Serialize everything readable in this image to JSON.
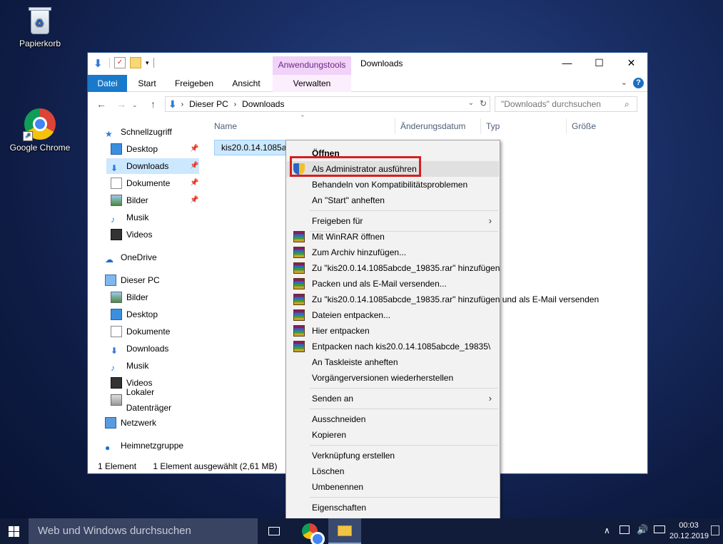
{
  "desktop": {
    "icons": [
      {
        "label": "Papierkorb",
        "icon": "recycle-bin-icon"
      },
      {
        "label": "Google Chrome",
        "icon": "chrome-icon"
      }
    ]
  },
  "explorer": {
    "title": "Downloads",
    "context_tab_header": "Anwendungstools",
    "ribbon_tabs": [
      "Datei",
      "Start",
      "Freigeben",
      "Ansicht",
      "Verwalten"
    ],
    "address": {
      "crumbs": [
        "Dieser PC",
        "Downloads"
      ]
    },
    "search_placeholder": "\"Downloads\" durchsuchen",
    "nav": {
      "quick_access": "Schnellzugriff",
      "quick_items": [
        "Desktop",
        "Downloads",
        "Dokumente",
        "Bilder",
        "Musik",
        "Videos"
      ],
      "onedrive": "OneDrive",
      "this_pc": "Dieser PC",
      "pc_items": [
        "Bilder",
        "Desktop",
        "Dokumente",
        "Downloads",
        "Musik",
        "Videos",
        "Lokaler Datenträger"
      ],
      "network": "Netzwerk",
      "homegroup": "Heimnetzgruppe"
    },
    "columns": [
      "Name",
      "Änderungsdatum",
      "Typ",
      "Größe"
    ],
    "file": {
      "name": "kis20.0.14.1085abcde_19835.exe"
    },
    "status": {
      "count": "1 Element",
      "selected": "1 Element ausgewählt (2,61 MB)"
    }
  },
  "context_menu": {
    "items": {
      "open": "Öffnen",
      "run_as_admin": "Als Administrator ausführen",
      "compat": "Behandeln von Kompatibilitätsproblemen",
      "pin_start": "An \"Start\" anheften",
      "share_with": "Freigeben für",
      "winrar_open": "Mit WinRAR öffnen",
      "add_archive": "Zum Archiv hinzufügen...",
      "add_rar": "Zu \"kis20.0.14.1085abcde_19835.rar\" hinzufügen",
      "pack_email": "Packen und als E-Mail versenden...",
      "add_rar_email": "Zu \"kis20.0.14.1085abcde_19835.rar\" hinzufügen und als E-Mail versenden",
      "extract_files": "Dateien entpacken...",
      "extract_here": "Hier entpacken",
      "extract_to": "Entpacken nach kis20.0.14.1085abcde_19835\\",
      "pin_taskbar": "An Taskleiste anheften",
      "restore_prev": "Vorgängerversionen wiederherstellen",
      "send_to": "Senden an",
      "cut": "Ausschneiden",
      "copy": "Kopieren",
      "shortcut": "Verknüpfung erstellen",
      "delete": "Löschen",
      "rename": "Umbenennen",
      "properties": "Eigenschaften"
    }
  },
  "taskbar": {
    "search_placeholder": "Web und Windows durchsuchen",
    "time": "00:03",
    "date": "20.12.2019"
  },
  "colors": {
    "accent": "#1979ca",
    "highlight_box": "#d32020",
    "selection": "#cce8ff"
  }
}
